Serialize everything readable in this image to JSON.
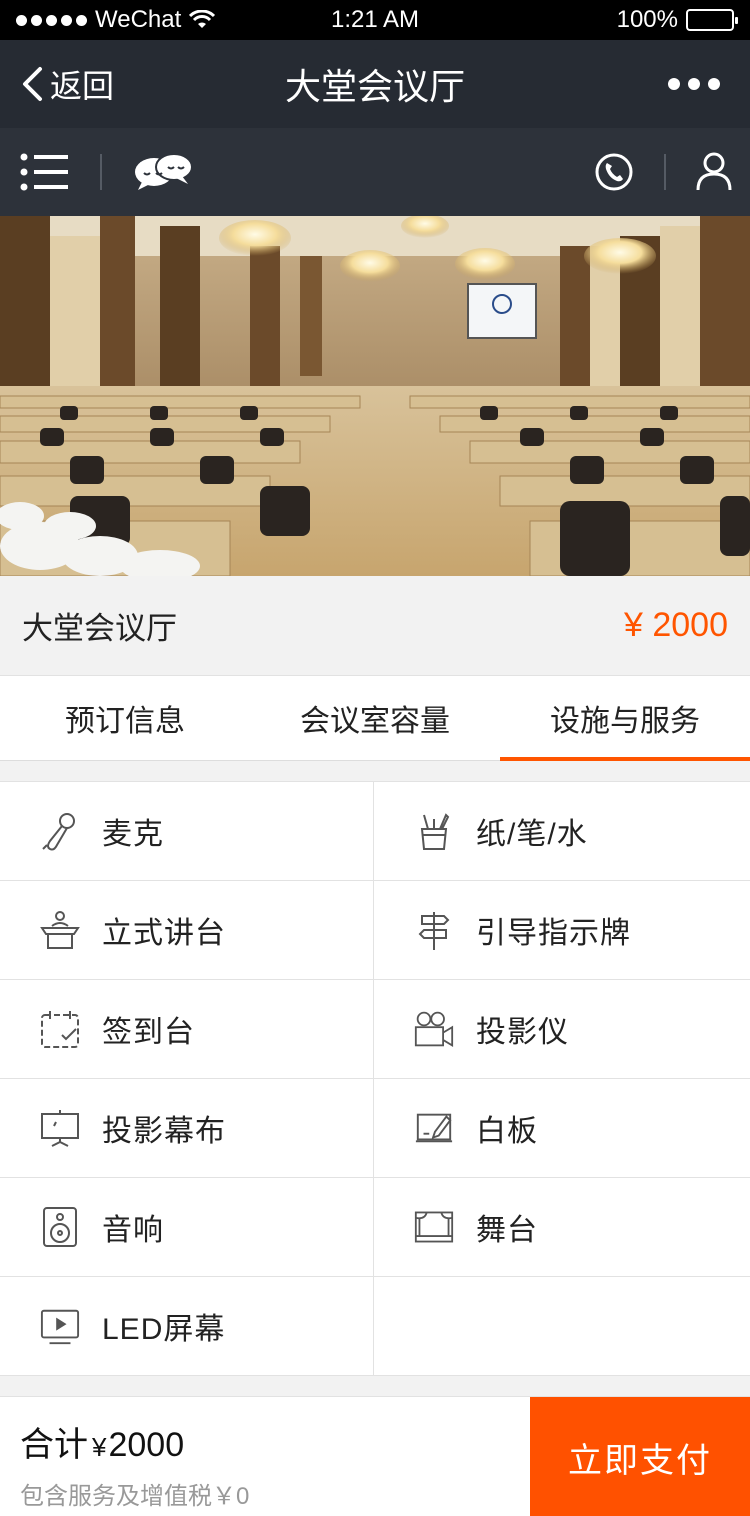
{
  "status_bar": {
    "carrier": "WeChat",
    "time": "1:21 AM",
    "battery": "100%",
    "battery_level": 1.0
  },
  "navbar": {
    "back_label": "返回",
    "title": "大堂会议厅"
  },
  "toolbar": {
    "icons": [
      "menu-list-icon",
      "chat-bubbles-icon",
      "phone-icon",
      "user-profile-icon"
    ]
  },
  "room": {
    "name": "大堂会议厅",
    "price": "¥ 2000"
  },
  "tabs": [
    {
      "label": "预订信息",
      "active": false
    },
    {
      "label": "会议室容量",
      "active": false
    },
    {
      "label": "设施与服务",
      "active": true
    }
  ],
  "facilities": [
    {
      "label": "麦克",
      "icon": "microphone-icon"
    },
    {
      "label": "纸/笔/水",
      "icon": "pen-cup-icon"
    },
    {
      "label": "立式讲台",
      "icon": "podium-icon"
    },
    {
      "label": "引导指示牌",
      "icon": "signpost-icon"
    },
    {
      "label": "签到台",
      "icon": "sign-in-calendar-icon"
    },
    {
      "label": "投影仪",
      "icon": "projector-icon"
    },
    {
      "label": "投影幕布",
      "icon": "projection-screen-icon"
    },
    {
      "label": "白板",
      "icon": "whiteboard-icon"
    },
    {
      "label": "音响",
      "icon": "speaker-icon"
    },
    {
      "label": "舞台",
      "icon": "stage-icon"
    },
    {
      "label": "LED屏幕",
      "icon": "led-screen-icon"
    }
  ],
  "footer": {
    "total_label": "合计",
    "total_currency": "¥",
    "total_amount": "2000",
    "note": "包含服务及增值税￥0",
    "pay_label": "立即支付"
  },
  "colors": {
    "accent": "#ff5500",
    "navbar": "#262b33",
    "toolbar": "#2d323a"
  }
}
